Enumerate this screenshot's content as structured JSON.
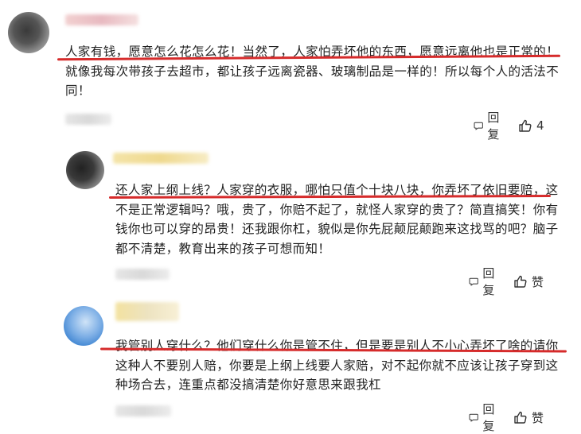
{
  "comments": [
    {
      "text": "人家有钱，愿意怎么花怎么花！当然了，人家怕弄坏他的东西，愿意远离他也是正常的！就像我每次带孩子去超市，都让孩子远离瓷器、玻璃制品是一样的！所以每个人的活法不同！",
      "reply_label": "回复",
      "like_label": "4"
    },
    {
      "text": "还人家上纲上线？人家穿的衣服，哪怕只值个十块八块，你弄坏了依旧要赔，这不是正常逻辑吗？哦，贵了，你赔不起了，就怪人家穿的贵了？简直搞笑！你有钱你也可以穿的昂贵！还我跟你杠，貌似是你先屁颠屁颠跑来这找骂的吧？脑子都不清楚，教育出来的孩子可想而知！",
      "reply_label": "回复",
      "like_label": "赞"
    },
    {
      "text": "我管别人穿什么？他们穿什么你是管不住，但是要是别人不小心弄坏了啥的请你这种人不要别人赔，你要是上纲上线要人家赔，对不起你就不应该让孩子穿到这种场合去，连重点都没搞清楚你好意思来跟我杠",
      "reply_label": "回复",
      "like_label": "赞"
    }
  ],
  "icons": {
    "reply": "comment-bubble-icon",
    "like": "thumbs-up-icon"
  },
  "colors": {
    "highlight_underline": "#d62b2b",
    "text": "#222222",
    "icon": "#333333"
  }
}
